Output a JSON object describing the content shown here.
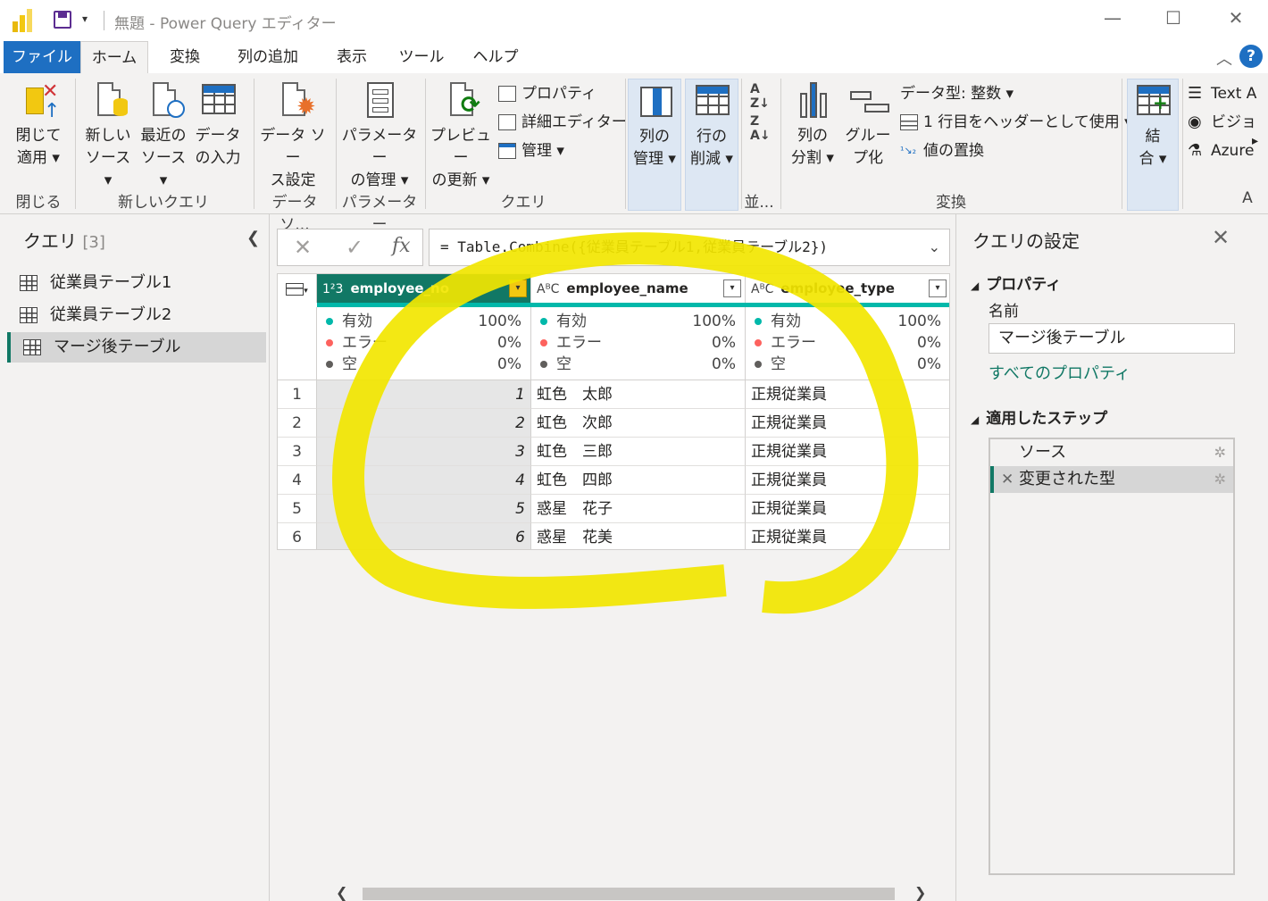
{
  "titlebar": {
    "title": "無題 - Power Query エディター",
    "minimize": "—",
    "maximize": "☐",
    "close": "✕",
    "quick_access_dropdown": "▾"
  },
  "tabs": [
    {
      "label": "ファイル"
    },
    {
      "label": "ホーム"
    },
    {
      "label": "変換"
    },
    {
      "label": "列の追加"
    },
    {
      "label": "表示"
    },
    {
      "label": "ツール"
    },
    {
      "label": "ヘルプ"
    }
  ],
  "ribbon": {
    "close_apply_1": "閉じて",
    "close_apply_2": "適用 ▾",
    "new_source_1": "新しい",
    "new_source_2": "ソース ▾",
    "recent_sources_1": "最近の",
    "recent_sources_2": "ソース ▾",
    "enter_data_1": "データ",
    "enter_data_2": "の入力",
    "data_source_settings_1": "データ ソー",
    "data_source_settings_2": "ス設定",
    "manage_params_1": "パラメーター",
    "manage_params_2": "の管理 ▾",
    "refresh_preview_1": "プレビュー",
    "refresh_preview_2": "の更新 ▾",
    "properties": "プロパティ",
    "advanced_editor": "詳細エディター",
    "manage": "管理 ▾",
    "manage_columns_1": "列の",
    "manage_columns_2": "管理 ▾",
    "reduce_rows_1": "行の",
    "reduce_rows_2": "削減 ▾",
    "split_column_1": "列の",
    "split_column_2": "分割 ▾",
    "group_by_1": "グルー",
    "group_by_2": "プ化",
    "data_type": "データ型: 整数 ▾",
    "use_first_row": "1 行目をヘッダーとして使用 ▾",
    "replace_values": "値の置換",
    "combine_1": "結",
    "combine_2": "合 ▾",
    "text_analytics": "Text A",
    "vision": "ビジョ",
    "azure_ml": "Azure",
    "more": "▸",
    "groups": {
      "close": "閉じる",
      "new_query": "新しいクエリ",
      "data_sources": "データ ソ...",
      "parameters": "パラメーター",
      "query": "クエリ",
      "sort": "並...",
      "transform": "変換",
      "ai": "A"
    }
  },
  "queries": {
    "header": "クエリ",
    "count": "[3]",
    "collapse": "❮",
    "items": [
      {
        "label": "従業員テーブル1"
      },
      {
        "label": "従業員テーブル2"
      },
      {
        "label": "マージ後テーブル"
      }
    ]
  },
  "formula": {
    "cancel": "✕",
    "confirm": "✓",
    "fx": "fx",
    "text": "= Table.Combine({従業員テーブル1,従業員テーブル2})",
    "expand": "⌄"
  },
  "grid": {
    "columns": [
      {
        "type": "1²3",
        "name": "employee_no",
        "valid": "有効",
        "valid_pct": "100%",
        "error": "エラー",
        "error_pct": "0%",
        "empty": "空",
        "empty_pct": "0%"
      },
      {
        "type": "AᴮC",
        "name": "employee_name",
        "valid": "有効",
        "valid_pct": "100%",
        "error": "エラー",
        "error_pct": "0%",
        "empty": "空",
        "empty_pct": "0%"
      },
      {
        "type": "AᴮC",
        "name": "employee_type",
        "valid": "有効",
        "valid_pct": "100%",
        "error": "エラー",
        "error_pct": "0%",
        "empty": "空",
        "empty_pct": "0%"
      }
    ],
    "rows": [
      {
        "n": "1",
        "no": "1",
        "name": "虹色　太郎",
        "type": "正規従業員"
      },
      {
        "n": "2",
        "no": "2",
        "name": "虹色　次郎",
        "type": "正規従業員"
      },
      {
        "n": "3",
        "no": "3",
        "name": "虹色　三郎",
        "type": "正規従業員"
      },
      {
        "n": "4",
        "no": "4",
        "name": "虹色　四郎",
        "type": "正規従業員"
      },
      {
        "n": "5",
        "no": "5",
        "name": "惑星　花子",
        "type": "正規従業員"
      },
      {
        "n": "6",
        "no": "6",
        "name": "惑星　花美",
        "type": "正規従業員"
      }
    ],
    "dropdown_glyph": "▾",
    "colors": {
      "valid": "#01b8aa",
      "error": "#fd625e",
      "empty": "#605e5c",
      "selected_header": "#117865"
    }
  },
  "settings": {
    "title": "クエリの設定",
    "close": "✕",
    "properties_header": "プロパティ",
    "name_label": "名前",
    "name_value": "マージ後テーブル",
    "all_properties": "すべてのプロパティ",
    "steps_header": "適用したステップ",
    "steps": [
      {
        "label": "ソース"
      },
      {
        "label": "変更された型"
      }
    ],
    "gear": "✲",
    "delete_step": "✕"
  },
  "scroll": {
    "left": "❮",
    "right": "❯"
  },
  "annotation_color": "#f2e600"
}
